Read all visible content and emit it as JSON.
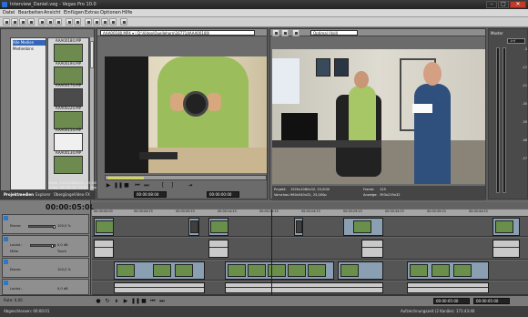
{
  "window": {
    "title": "Interview_Daniel.veg - Vegas Pro 10.0",
    "minimize": "–",
    "maximize": "□",
    "close": "✕"
  },
  "menu": [
    "Datei",
    "Bearbeiten",
    "Ansicht",
    "Einfügen",
    "Extras",
    "Optionen",
    "Hilfe"
  ],
  "explorer": {
    "tree_items": [
      "Alle Medien",
      "Medienbins"
    ],
    "thumbs": [
      "AAA00180.MP",
      "AAA00190.MP",
      "AAA00170.MP",
      "AAA00220.MP",
      "AAA00150.MP",
      "AAA00130.MP",
      "AAA00100.MP",
      "AAA00100.MP"
    ],
    "info_lines": [
      "Video: 1920x1080x32, 25,000 fps",
      "Audio: 48.000 Hz, 16 Bit, Stereo"
    ],
    "tabs": [
      "Projektmedien",
      "Explorer",
      "Übergänge",
      "Video-FX",
      "Medien"
    ]
  },
  "trimmer": {
    "path": "AAA00180.MP4 ▾ | D:\\Video\\Ouellehorn\\167714AAA00180|",
    "timecode_in": "00:00:08:04",
    "timecode_out": "00:00:00:00"
  },
  "preview": {
    "mode": "Optimal (Voll)",
    "info": {
      "project_label": "Projekt:",
      "project_val": "1920x1080x32, 25,000i",
      "preview_label": "Vorschau:",
      "preview_val": "960x540x32, 25,000p",
      "frame_label": "Frame:",
      "frame_val": "125",
      "display_label": "Anzeige:",
      "display_val": "393x219x32"
    }
  },
  "meter": {
    "title": "Master",
    "gauge": "-Inf",
    "scale": [
      "-3",
      "-6",
      "-9",
      "-12",
      "-15",
      "-18",
      "-21",
      "-24",
      "-27",
      "-30",
      "-33",
      "-36",
      "-39",
      "-42",
      "-45",
      "-48",
      "-51",
      "-54",
      "-57"
    ]
  },
  "timeline": {
    "timecode": "00:00:05:00",
    "ruler": [
      "00:00:00:00",
      "00:00:04:23",
      "00:00:09:23",
      "00:00:14:23",
      "00:00:19:23",
      "00:00:24:23",
      "00:00:29:23",
      "00:00:34:23",
      "00:00:39:23",
      "00:00:44:23",
      "00:00:49:23"
    ],
    "tracks": [
      {
        "label": "Ebene:",
        "value": "100,0 %"
      },
      {
        "label": "Lautst.:",
        "value": "0,0 dB"
      },
      {
        "label": "Touch",
        "value": "Mitte"
      },
      {
        "label": "Ebene:",
        "value": "100,0 %"
      },
      {
        "label": "Lautst.:",
        "value": "0,0 dB"
      }
    ],
    "rate": "Rate: 0,00",
    "tc_left": "00:00:05:00",
    "tc_right": "00:00:05:00"
  },
  "status": {
    "left": "Abgeschlossen: 00:00:01",
    "right": "Aufzeichnungszeit (2 Kanäle): 171:43:40"
  }
}
